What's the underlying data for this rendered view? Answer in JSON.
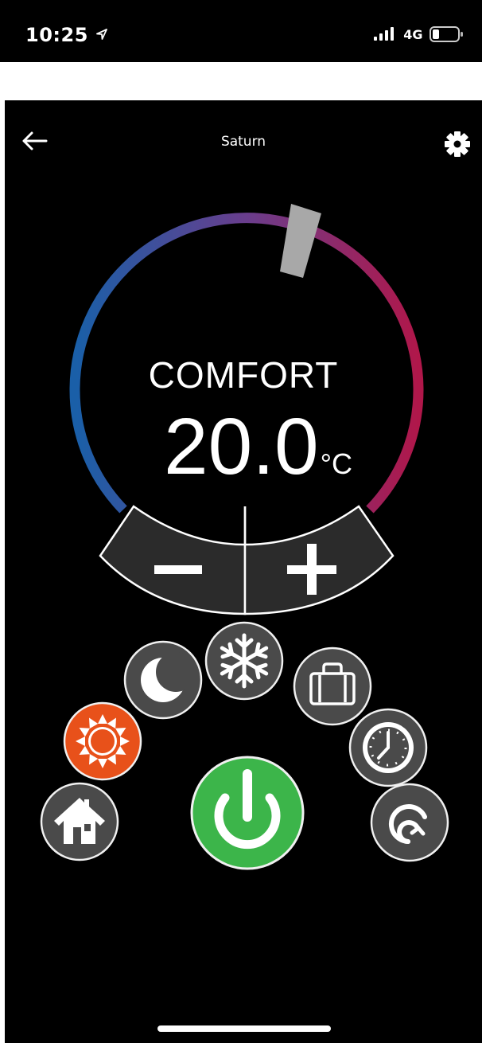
{
  "status_bar": {
    "time": "10:25",
    "network": "4G",
    "location_icon": "location-arrow-icon",
    "signal_icon": "signal-bars-icon",
    "battery_icon": "battery-low-icon"
  },
  "header": {
    "title": "Saturn",
    "back_icon": "arrow-left-icon",
    "settings_icon": "gear-icon"
  },
  "thermostat": {
    "mode": "COMFORT",
    "temperature": "20.0",
    "unit": "°C",
    "dial_colors": {
      "cold": "#1a5fa8",
      "mid": "#6a3d8c",
      "hot": "#b0174a"
    },
    "handle_color": "#a8a8a8",
    "decrease_icon": "minus-icon",
    "increase_icon": "plus-icon"
  },
  "modes": [
    {
      "name": "home",
      "icon": "house-icon"
    },
    {
      "name": "comfort",
      "icon": "sun-icon",
      "active": true,
      "color": "#e8511a"
    },
    {
      "name": "eco",
      "icon": "moon-icon"
    },
    {
      "name": "frost",
      "icon": "snowflake-icon"
    },
    {
      "name": "holiday",
      "icon": "suitcase-icon"
    },
    {
      "name": "timer",
      "icon": "clock-icon"
    },
    {
      "name": "auto",
      "icon": "cycle-icon"
    }
  ],
  "power": {
    "icon": "power-icon",
    "color": "#3cb54a"
  }
}
